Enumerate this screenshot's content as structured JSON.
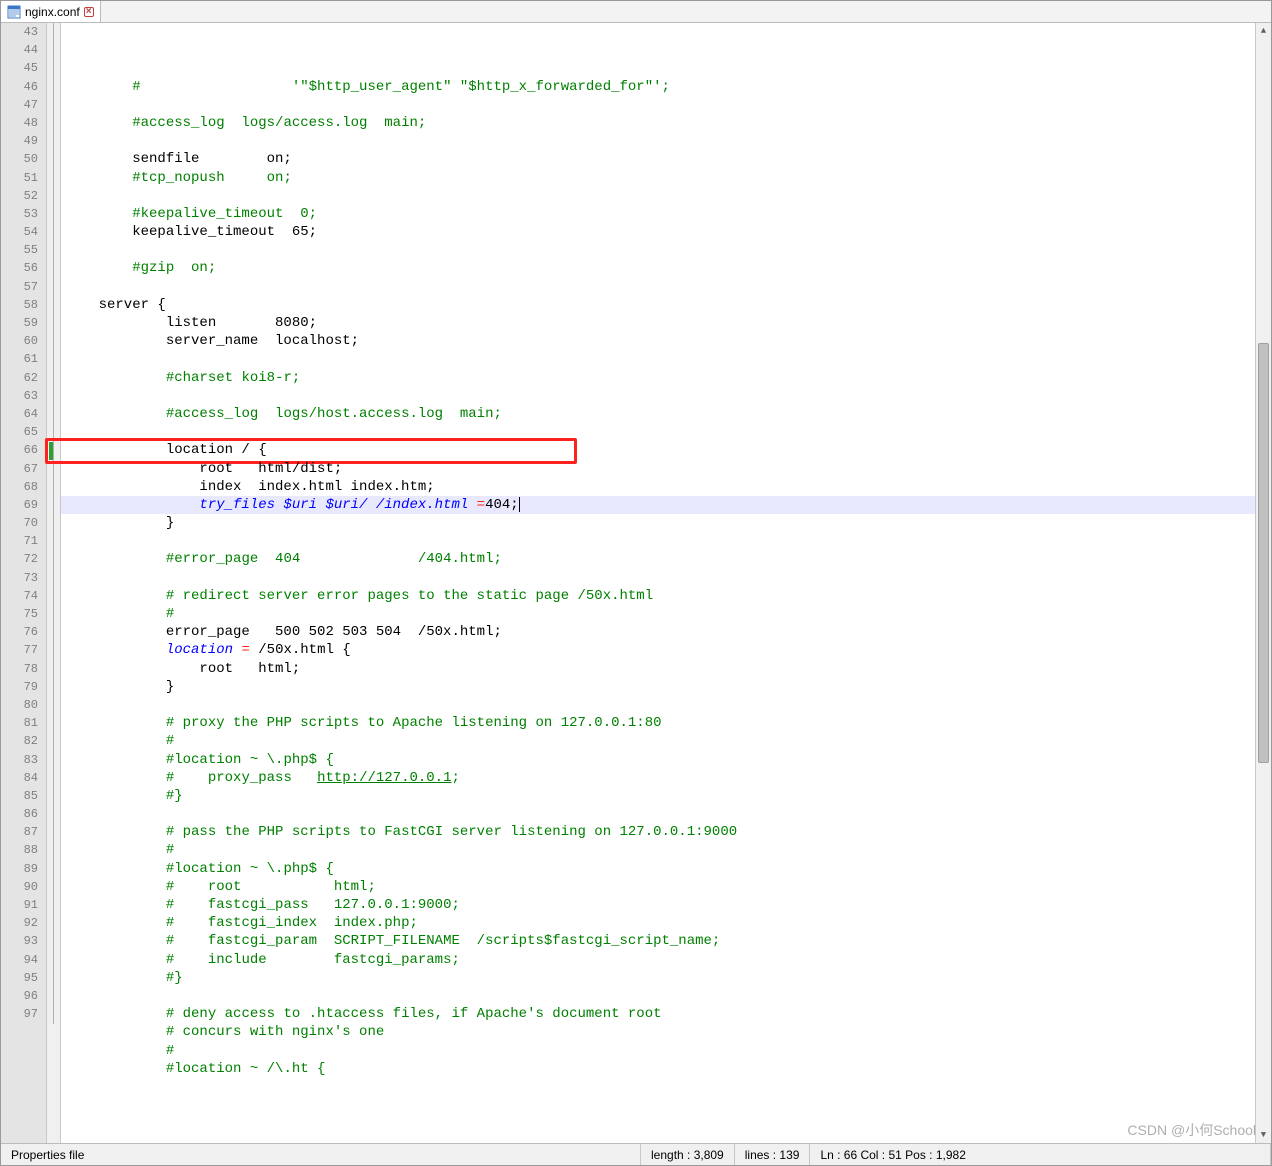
{
  "tab": {
    "filename": "nginx.conf"
  },
  "editor": {
    "first_line": 43,
    "highlighted_line": 66,
    "lines": [
      {
        "n": 43,
        "segs": [
          {
            "t": "        ",
            "c": ""
          },
          {
            "t": "#                  '\"$http_user_agent\" \"$http_x_forwarded_for\"';",
            "c": "c-comment"
          }
        ]
      },
      {
        "n": 44,
        "segs": []
      },
      {
        "n": 45,
        "segs": [
          {
            "t": "        ",
            "c": ""
          },
          {
            "t": "#access_log  logs/access.log  main;",
            "c": "c-comment"
          }
        ]
      },
      {
        "n": 46,
        "segs": []
      },
      {
        "n": 47,
        "segs": [
          {
            "t": "        sendfile        on;",
            "c": ""
          }
        ]
      },
      {
        "n": 48,
        "segs": [
          {
            "t": "        ",
            "c": ""
          },
          {
            "t": "#tcp_nopush     on;",
            "c": "c-comment"
          }
        ]
      },
      {
        "n": 49,
        "segs": []
      },
      {
        "n": 50,
        "segs": [
          {
            "t": "        ",
            "c": ""
          },
          {
            "t": "#keepalive_timeout  0;",
            "c": "c-comment"
          }
        ]
      },
      {
        "n": 51,
        "segs": [
          {
            "t": "        keepalive_timeout  65;",
            "c": ""
          }
        ]
      },
      {
        "n": 52,
        "segs": []
      },
      {
        "n": 53,
        "segs": [
          {
            "t": "        ",
            "c": ""
          },
          {
            "t": "#gzip  on;",
            "c": "c-comment"
          }
        ]
      },
      {
        "n": 54,
        "segs": []
      },
      {
        "n": 55,
        "segs": [
          {
            "t": "    server {",
            "c": ""
          }
        ]
      },
      {
        "n": 56,
        "segs": [
          {
            "t": "            listen       8080;",
            "c": ""
          }
        ]
      },
      {
        "n": 57,
        "segs": [
          {
            "t": "            server_name  localhost;",
            "c": ""
          }
        ]
      },
      {
        "n": 58,
        "segs": []
      },
      {
        "n": 59,
        "segs": [
          {
            "t": "            ",
            "c": ""
          },
          {
            "t": "#charset koi8-r;",
            "c": "c-comment"
          }
        ]
      },
      {
        "n": 60,
        "segs": []
      },
      {
        "n": 61,
        "segs": [
          {
            "t": "            ",
            "c": ""
          },
          {
            "t": "#access_log  logs/host.access.log  main;",
            "c": "c-comment"
          }
        ]
      },
      {
        "n": 62,
        "segs": []
      },
      {
        "n": 63,
        "segs": [
          {
            "t": "            location / {",
            "c": ""
          }
        ]
      },
      {
        "n": 64,
        "segs": [
          {
            "t": "                root   html/dist;",
            "c": ""
          }
        ]
      },
      {
        "n": 65,
        "segs": [
          {
            "t": "                index  index.html index.htm;",
            "c": ""
          }
        ]
      },
      {
        "n": 66,
        "segs": [
          {
            "t": "                ",
            "c": ""
          },
          {
            "t": "try_files $uri $uri/ /index.html ",
            "c": "c-keyword"
          },
          {
            "t": "=",
            "c": "c-op"
          },
          {
            "t": "404;",
            "c": ""
          }
        ],
        "current": true,
        "caret": true
      },
      {
        "n": 67,
        "segs": [
          {
            "t": "            }",
            "c": ""
          }
        ]
      },
      {
        "n": 68,
        "segs": []
      },
      {
        "n": 69,
        "segs": [
          {
            "t": "            ",
            "c": ""
          },
          {
            "t": "#error_page  404              /404.html;",
            "c": "c-comment"
          }
        ]
      },
      {
        "n": 70,
        "segs": []
      },
      {
        "n": 71,
        "segs": [
          {
            "t": "            ",
            "c": ""
          },
          {
            "t": "# redirect server error pages to the static page /50x.html",
            "c": "c-comment"
          }
        ]
      },
      {
        "n": 72,
        "segs": [
          {
            "t": "            ",
            "c": ""
          },
          {
            "t": "#",
            "c": "c-comment"
          }
        ]
      },
      {
        "n": 73,
        "segs": [
          {
            "t": "            error_page   500 502 503 504  /50x.html;",
            "c": ""
          }
        ]
      },
      {
        "n": 74,
        "segs": [
          {
            "t": "            ",
            "c": ""
          },
          {
            "t": "location",
            "c": "c-keyword"
          },
          {
            "t": " ",
            "c": ""
          },
          {
            "t": "=",
            "c": "c-op"
          },
          {
            "t": " /50x.html {",
            "c": ""
          }
        ]
      },
      {
        "n": 75,
        "segs": [
          {
            "t": "                root   html;",
            "c": ""
          }
        ]
      },
      {
        "n": 76,
        "segs": [
          {
            "t": "            }",
            "c": ""
          }
        ]
      },
      {
        "n": 77,
        "segs": []
      },
      {
        "n": 78,
        "segs": [
          {
            "t": "            ",
            "c": ""
          },
          {
            "t": "# proxy the PHP scripts to Apache listening on 127.0.0.1:80",
            "c": "c-comment"
          }
        ]
      },
      {
        "n": 79,
        "segs": [
          {
            "t": "            ",
            "c": ""
          },
          {
            "t": "#",
            "c": "c-comment"
          }
        ]
      },
      {
        "n": 80,
        "segs": [
          {
            "t": "            ",
            "c": ""
          },
          {
            "t": "#location ~ \\.php$ {",
            "c": "c-comment"
          }
        ]
      },
      {
        "n": 81,
        "segs": [
          {
            "t": "            ",
            "c": ""
          },
          {
            "t": "#    proxy_pass   ",
            "c": "c-comment"
          },
          {
            "t": "http://127.0.0.1",
            "c": "c-link"
          },
          {
            "t": ";",
            "c": "c-comment"
          }
        ]
      },
      {
        "n": 82,
        "segs": [
          {
            "t": "            ",
            "c": ""
          },
          {
            "t": "#}",
            "c": "c-comment"
          }
        ]
      },
      {
        "n": 83,
        "segs": []
      },
      {
        "n": 84,
        "segs": [
          {
            "t": "            ",
            "c": ""
          },
          {
            "t": "# pass the PHP scripts to FastCGI server listening on 127.0.0.1:9000",
            "c": "c-comment"
          }
        ]
      },
      {
        "n": 85,
        "segs": [
          {
            "t": "            ",
            "c": ""
          },
          {
            "t": "#",
            "c": "c-comment"
          }
        ]
      },
      {
        "n": 86,
        "segs": [
          {
            "t": "            ",
            "c": ""
          },
          {
            "t": "#location ~ \\.php$ {",
            "c": "c-comment"
          }
        ]
      },
      {
        "n": 87,
        "segs": [
          {
            "t": "            ",
            "c": ""
          },
          {
            "t": "#    root           html;",
            "c": "c-comment"
          }
        ]
      },
      {
        "n": 88,
        "segs": [
          {
            "t": "            ",
            "c": ""
          },
          {
            "t": "#    fastcgi_pass   127.0.0.1:9000;",
            "c": "c-comment"
          }
        ]
      },
      {
        "n": 89,
        "segs": [
          {
            "t": "            ",
            "c": ""
          },
          {
            "t": "#    fastcgi_index  index.php;",
            "c": "c-comment"
          }
        ]
      },
      {
        "n": 90,
        "segs": [
          {
            "t": "            ",
            "c": ""
          },
          {
            "t": "#    fastcgi_param  SCRIPT_FILENAME  /scripts$fastcgi_script_name;",
            "c": "c-comment"
          }
        ]
      },
      {
        "n": 91,
        "segs": [
          {
            "t": "            ",
            "c": ""
          },
          {
            "t": "#    include        fastcgi_params;",
            "c": "c-comment"
          }
        ]
      },
      {
        "n": 92,
        "segs": [
          {
            "t": "            ",
            "c": ""
          },
          {
            "t": "#}",
            "c": "c-comment"
          }
        ]
      },
      {
        "n": 93,
        "segs": []
      },
      {
        "n": 94,
        "segs": [
          {
            "t": "            ",
            "c": ""
          },
          {
            "t": "# deny access to .htaccess files, if Apache's document root",
            "c": "c-comment"
          }
        ]
      },
      {
        "n": 95,
        "segs": [
          {
            "t": "            ",
            "c": ""
          },
          {
            "t": "# concurs with nginx's one",
            "c": "c-comment"
          }
        ]
      },
      {
        "n": 96,
        "segs": [
          {
            "t": "            ",
            "c": ""
          },
          {
            "t": "#",
            "c": "c-comment"
          }
        ]
      },
      {
        "n": 97,
        "segs": [
          {
            "t": "            ",
            "c": ""
          },
          {
            "t": "#location ~ /\\.ht {",
            "c": "c-comment"
          }
        ]
      }
    ]
  },
  "statusbar": {
    "filetype": "Properties file",
    "length_label": "length : 3,809",
    "lines_label": "lines : 139",
    "pos_label": "Ln : 66    Col : 51    Pos : 1,982"
  },
  "watermark": "CSDN @小何School"
}
